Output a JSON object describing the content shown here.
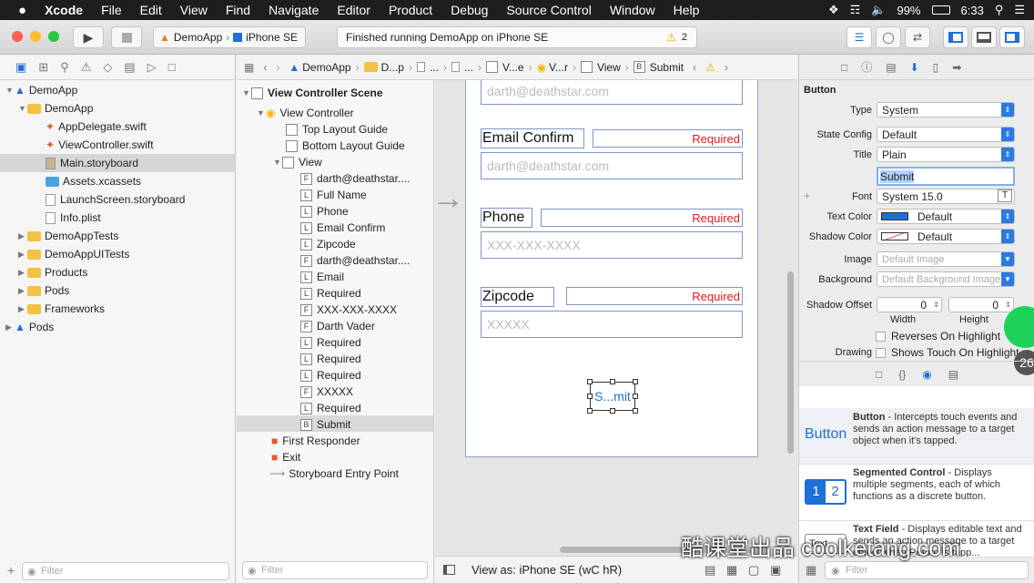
{
  "menubar": {
    "apple": "",
    "app": "Xcode",
    "items": [
      "File",
      "Edit",
      "View",
      "Find",
      "Navigate",
      "Editor",
      "Product",
      "Debug",
      "Source Control",
      "Window",
      "Help"
    ],
    "battery": "99%",
    "time": "6:33"
  },
  "toolbar": {
    "scheme_target": "DemoApp",
    "scheme_device": "iPhone SE",
    "activity": "Finished running DemoApp on iPhone SE",
    "warnings": "2"
  },
  "navigator": {
    "items": [
      {
        "label": "DemoApp",
        "kind": "project"
      },
      {
        "label": "DemoApp",
        "kind": "folder"
      },
      {
        "label": "AppDelegate.swift",
        "kind": "file"
      },
      {
        "label": "ViewController.swift",
        "kind": "file"
      },
      {
        "label": "Main.storyboard",
        "kind": "file"
      },
      {
        "label": "Assets.xcassets",
        "kind": "folder"
      },
      {
        "label": "LaunchScreen.storyboard",
        "kind": "file"
      },
      {
        "label": "Info.plist",
        "kind": "file"
      },
      {
        "label": "DemoAppTests",
        "kind": "folder"
      },
      {
        "label": "DemoAppUITests",
        "kind": "folder"
      },
      {
        "label": "Products",
        "kind": "folder"
      },
      {
        "label": "Pods",
        "kind": "folder"
      },
      {
        "label": "Frameworks",
        "kind": "folder"
      },
      {
        "label": "Pods",
        "kind": "project"
      }
    ],
    "filter_placeholder": "Filter"
  },
  "jumpbar": [
    "DemoApp",
    "D...p",
    "...",
    "...",
    "V...e",
    "V...r",
    "View",
    "Submit"
  ],
  "outline": {
    "scene": "View Controller Scene",
    "items": [
      {
        "label": "View Controller",
        "kind": "vc"
      },
      {
        "label": "Top Layout Guide",
        "kind": "guide"
      },
      {
        "label": "Bottom Layout Guide",
        "kind": "guide"
      },
      {
        "label": "View",
        "kind": "view"
      },
      {
        "label": "darth@deathstar....",
        "kind": "F"
      },
      {
        "label": "Full Name",
        "kind": "L"
      },
      {
        "label": "Phone",
        "kind": "L"
      },
      {
        "label": "Email Confirm",
        "kind": "L"
      },
      {
        "label": "Zipcode",
        "kind": "L"
      },
      {
        "label": "darth@deathstar....",
        "kind": "F"
      },
      {
        "label": "Email",
        "kind": "L"
      },
      {
        "label": "Required",
        "kind": "L"
      },
      {
        "label": "XXX-XXX-XXXX",
        "kind": "F"
      },
      {
        "label": "Darth Vader",
        "kind": "F"
      },
      {
        "label": "Required",
        "kind": "L"
      },
      {
        "label": "Required",
        "kind": "L"
      },
      {
        "label": "Required",
        "kind": "L"
      },
      {
        "label": "XXXXX",
        "kind": "F"
      },
      {
        "label": "Required",
        "kind": "L"
      },
      {
        "label": "Submit",
        "kind": "B"
      }
    ],
    "first_responder": "First Responder",
    "exit": "Exit",
    "entry_point": "Storyboard Entry Point",
    "filter_placeholder": "Filter"
  },
  "canvas": {
    "email_placeholder": "darth@deathstar.com",
    "email_confirm_label": "Email Confirm",
    "required": "Required",
    "email_confirm_placeholder": "darth@deathstar.com",
    "phone_label": "Phone",
    "phone_placeholder": "XXX-XXX-XXXX",
    "zipcode_label": "Zipcode",
    "zip_placeholder": "XXXXX",
    "submit_button": "S...mit",
    "view_as": "View as: iPhone SE (wC hR)"
  },
  "inspector": {
    "section": "Button",
    "type_label": "Type",
    "type_value": "System",
    "state_label": "State Config",
    "state_value": "Default",
    "title_label": "Title",
    "title_value": "Plain",
    "title_text": "Submit",
    "font_label": "Font",
    "font_value": "System 15.0",
    "textcolor_label": "Text Color",
    "textcolor_value": "Default",
    "shadowcolor_label": "Shadow Color",
    "shadowcolor_value": "Default",
    "image_label": "Image",
    "image_placeholder": "Default Image",
    "background_label": "Background",
    "background_placeholder": "Default Background Image",
    "shadow_offset_label": "Shadow Offset",
    "width_value": "0",
    "height_value": "0",
    "width_label": "Width",
    "height_label": "Height",
    "reverses": "Reverses On Highlight",
    "drawing_label": "Drawing",
    "shows_touch": "Shows Touch On Highlight",
    "badge": "26"
  },
  "library": {
    "items": [
      {
        "icon_text": "Button",
        "title": "Button",
        "desc": " - Intercepts touch events and sends an action message to a target object when it's tapped."
      },
      {
        "icon_text": "1 2",
        "title": "Segmented Control",
        "desc": " - Displays multiple segments, each of which functions as a discrete button."
      },
      {
        "icon_text": "Text",
        "title": "Text Field",
        "desc": " - Displays editable text and sends an action message to a target object when Return is tapp..."
      }
    ],
    "filter_placeholder": "Filter"
  },
  "watermark": "酷课堂出品 coolketang.com",
  "colors": {
    "accent": "#2a7ae2",
    "required": "#e0191f",
    "folder": "#f4c242"
  }
}
